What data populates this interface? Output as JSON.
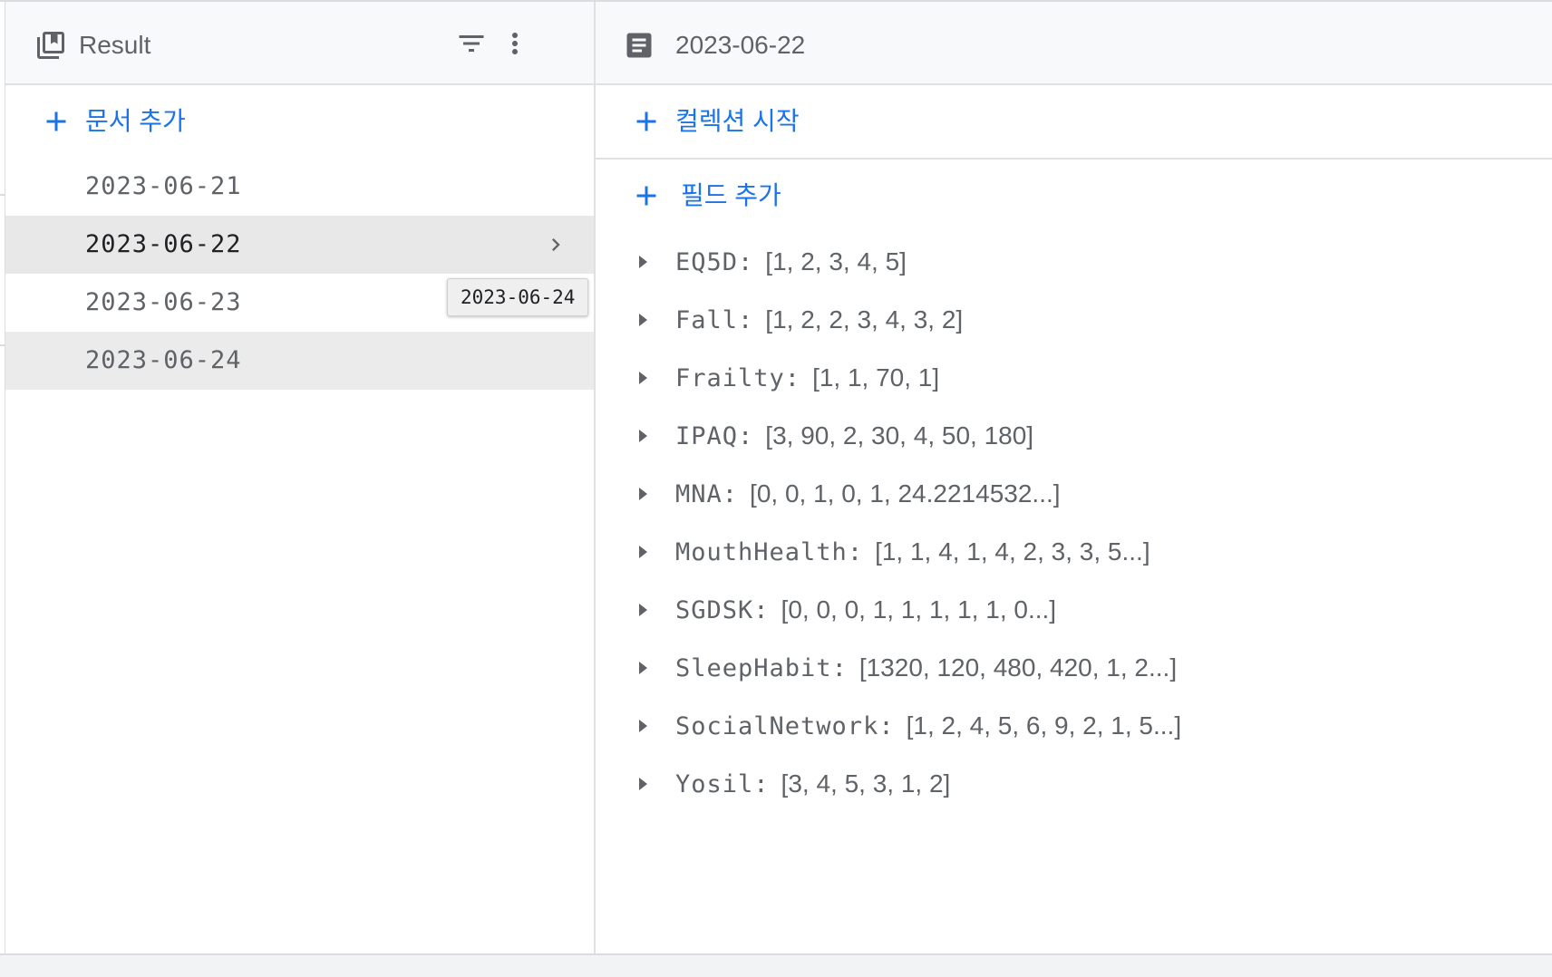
{
  "left_panel": {
    "title": "Result",
    "add_document_label": "문서 추가",
    "documents": [
      {
        "id": "2023-06-21"
      },
      {
        "id": "2023-06-22"
      },
      {
        "id": "2023-06-23"
      },
      {
        "id": "2023-06-24"
      }
    ],
    "selected_document": "2023-06-22",
    "tooltip_text": "2023-06-24"
  },
  "right_panel": {
    "title": "2023-06-22",
    "start_collection_label": "컬렉션 시작",
    "add_field_label": "필드 추가",
    "fields": [
      {
        "key": "EQ5D",
        "value": "[1, 2, 3, 4, 5]"
      },
      {
        "key": "Fall",
        "value": "[1, 2, 2, 3, 4, 3, 2]"
      },
      {
        "key": "Frailty",
        "value": "[1, 1, 70, 1]"
      },
      {
        "key": "IPAQ",
        "value": "[3, 90, 2, 30, 4, 50, 180]"
      },
      {
        "key": "MNA",
        "value": "[0, 0, 1, 0, 1, 24.2214532...]"
      },
      {
        "key": "MouthHealth",
        "value": "[1, 1, 4, 1, 4, 2, 3, 3, 5...]"
      },
      {
        "key": "SGDSK",
        "value": "[0, 0, 0, 1, 1, 1, 1, 1, 0...]"
      },
      {
        "key": "SleepHabit",
        "value": "[1320, 120, 480, 420, 1, 2...]"
      },
      {
        "key": "SocialNetwork",
        "value": "[1, 2, 4, 5, 6, 9, 2, 1, 5...]"
      },
      {
        "key": "Yosil",
        "value": "[3, 4, 5, 3, 1, 2]"
      }
    ]
  },
  "icons": {
    "collection": "collection-icon",
    "filter": "filter-icon",
    "more": "more-vert-icon",
    "document": "document-icon",
    "plus": "plus-icon",
    "chevron": "chevron-right-icon",
    "caret": "caret-right-icon"
  },
  "colors": {
    "accent": "#1a73e8",
    "text_secondary": "#5f6368",
    "text_primary": "#202124",
    "header_bg": "#f8f9fa",
    "selected_bg": "#e8e8e8",
    "divider": "#e0e0e0"
  }
}
